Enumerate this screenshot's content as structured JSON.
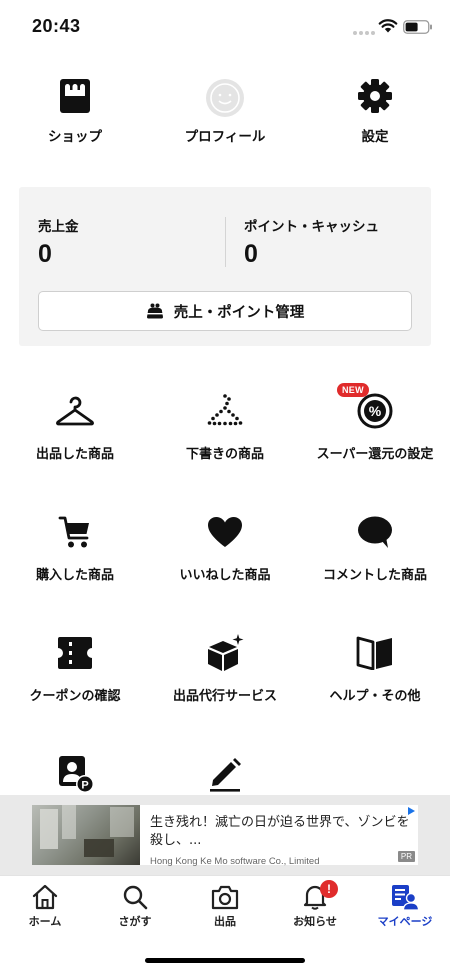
{
  "status_bar": {
    "time": "20:43"
  },
  "top_menu": [
    {
      "label": "ショップ",
      "icon": "shop-icon"
    },
    {
      "label": "プロフィール",
      "icon": "profile-avatar-icon"
    },
    {
      "label": "設定",
      "icon": "gear-icon"
    }
  ],
  "sales": {
    "sales_label": "売上金",
    "sales_value": "0",
    "points_label": "ポイント・キャッシュ",
    "points_value": "0",
    "manage_button": "売上・ポイント管理"
  },
  "menu": [
    {
      "label": "出品した商品",
      "icon": "hanger-icon"
    },
    {
      "label": "下書きの商品",
      "icon": "dotted-hanger-icon"
    },
    {
      "label": "スーパー還元の設定",
      "icon": "percent-badge-icon",
      "badge": "NEW"
    },
    {
      "label": "購入した商品",
      "icon": "cart-icon"
    },
    {
      "label": "いいねした商品",
      "icon": "heart-icon"
    },
    {
      "label": "コメントした商品",
      "icon": "comment-icon"
    },
    {
      "label": "クーポンの確認",
      "icon": "ticket-icon"
    },
    {
      "label": "出品代行サービス",
      "icon": "box-sparkle-icon"
    },
    {
      "label": "ヘルプ・その他",
      "icon": "book-icon"
    },
    {
      "label": "",
      "icon": "profile-card-icon"
    },
    {
      "label": "",
      "icon": "pen-icon"
    }
  ],
  "ad": {
    "title": "生き残れ！滅亡の日が迫る世界で、ゾンビを殺し、...",
    "sponsor": "Hong Kong Ke Mo software Co., Limited",
    "tag": "PR"
  },
  "tabbar": {
    "items": [
      {
        "label": "ホーム",
        "icon": "home-icon"
      },
      {
        "label": "さがす",
        "icon": "search-icon"
      },
      {
        "label": "出品",
        "icon": "camera-icon"
      },
      {
        "label": "お知らせ",
        "icon": "bell-icon",
        "badge": "!"
      },
      {
        "label": "マイページ",
        "icon": "mypage-icon",
        "active": true
      }
    ]
  },
  "colors": {
    "accent": "#1b3fc7",
    "badge": "#e02b2b",
    "panel": "#f3f3f3"
  }
}
